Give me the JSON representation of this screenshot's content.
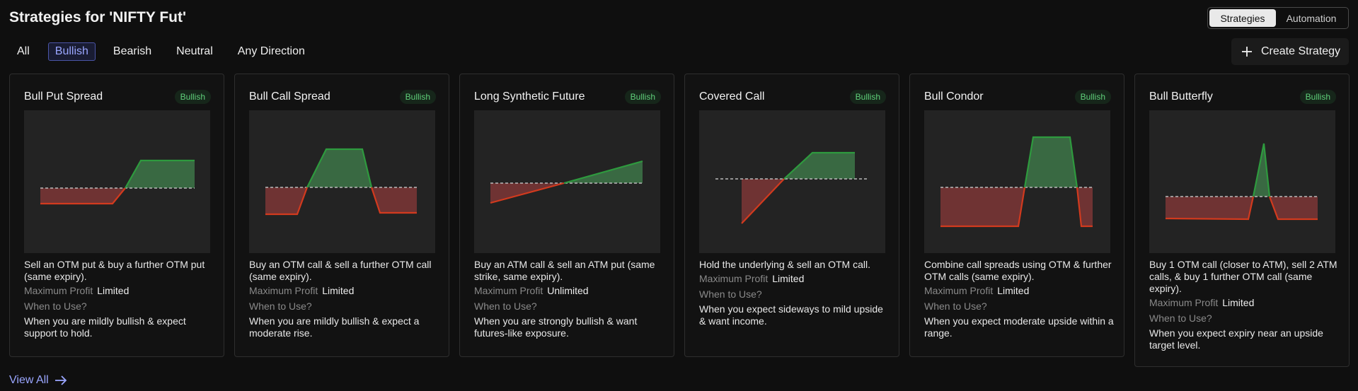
{
  "header": {
    "title": "Strategies for 'NIFTY Fut'",
    "toggle": {
      "strategies": "Strategies",
      "automation": "Automation"
    }
  },
  "tabs": [
    "All",
    "Bullish",
    "Bearish",
    "Neutral",
    "Any Direction"
  ],
  "create_button": "Create Strategy",
  "view_all": "View All",
  "cards": [
    {
      "title": "Bull Put Spread",
      "badge": "Bullish",
      "desc": "Sell an OTM put & buy a further OTM put (same expiry).",
      "profit_label": "Maximum Profit",
      "profit_value": "Limited",
      "when_label": "When to Use?",
      "when_text": "When you are mildly bullish & expect support to hold."
    },
    {
      "title": "Bull Call Spread",
      "badge": "Bullish",
      "desc": "Buy an OTM call & sell a further OTM call (same expiry).",
      "profit_label": "Maximum Profit",
      "profit_value": "Limited",
      "when_label": "When to Use?",
      "when_text": "When you are mildly bullish & expect a moderate rise."
    },
    {
      "title": "Long Synthetic Future",
      "badge": "Bullish",
      "desc": "Buy an ATM call & sell an ATM put (same strike, same expiry).",
      "profit_label": "Maximum Profit",
      "profit_value": "Unlimited",
      "when_label": "When to Use?",
      "when_text": "When you are strongly bullish & want futures-like exposure."
    },
    {
      "title": "Covered Call",
      "badge": "Bullish",
      "desc": "Hold the underlying & sell an OTM call.",
      "profit_label": "Maximum Profit",
      "profit_value": "Limited",
      "when_label": "When to Use?",
      "when_text": "When you expect sideways to mild upside & want income."
    },
    {
      "title": "Bull Condor",
      "badge": "Bullish",
      "desc": "Combine call spreads using OTM & further OTM calls (same expiry).",
      "profit_label": "Maximum Profit",
      "profit_value": "Limited",
      "when_label": "When to Use?",
      "when_text": "When you expect moderate upside within a range."
    },
    {
      "title": "Bull Butterfly",
      "badge": "Bullish",
      "desc": "Buy 1 OTM call (closer to ATM), sell 2 ATM calls, & buy 1 further OTM call (same expiry).",
      "profit_label": "Maximum Profit",
      "profit_value": "Limited",
      "when_label": "When to Use?",
      "when_text": "When you expect expiry near an upside target level."
    }
  ],
  "colors": {
    "profit": "#2e9a3e",
    "loss": "#c8321e",
    "accent": "#9aa6ff"
  }
}
